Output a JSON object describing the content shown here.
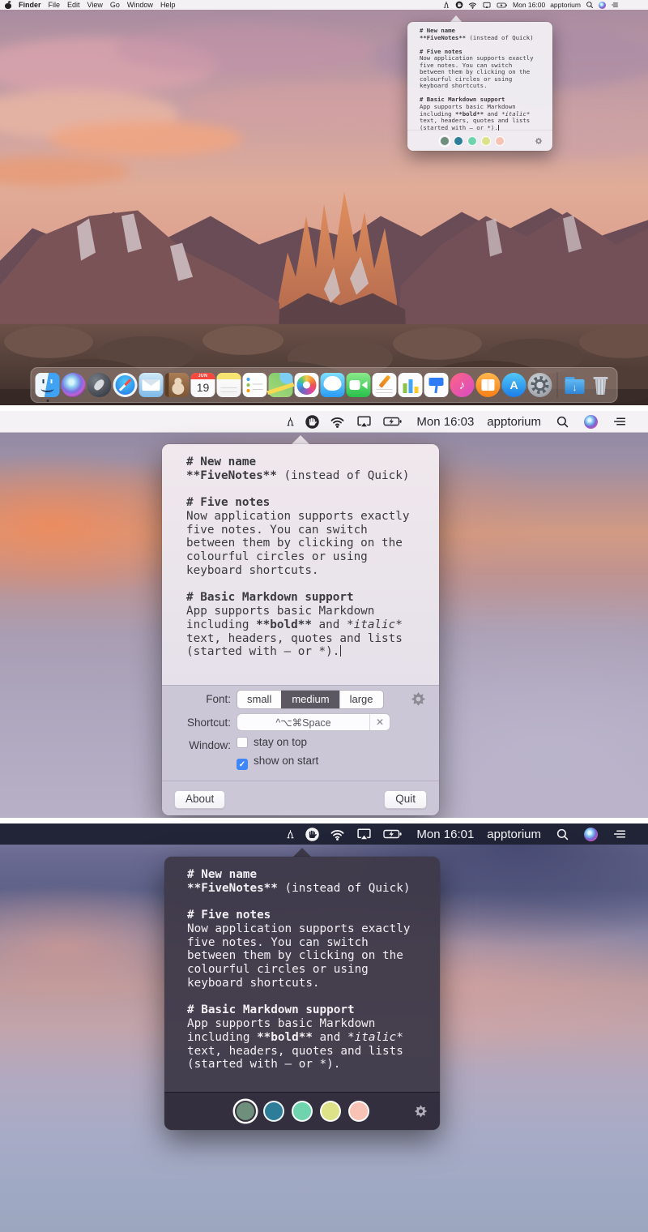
{
  "menubar_small": {
    "menus": [
      "Finder",
      "File",
      "Edit",
      "View",
      "Go",
      "Window",
      "Help"
    ],
    "time": "Mon 16:00",
    "user": "apptorium"
  },
  "menubar_light": {
    "time": "Mon 16:03",
    "user": "apptorium"
  },
  "menubar_dark": {
    "time": "Mon 16:01",
    "user": "apptorium"
  },
  "icons": {
    "menubar_status": [
      "caliper-icon",
      "fivenotes-hand-icon",
      "wifi-icon",
      "airplay-display-icon",
      "battery-charging-icon",
      "spotlight-search-icon",
      "siri-icon",
      "notification-center-icon"
    ],
    "popover": [
      "settings-gear-icon"
    ]
  },
  "note": {
    "lines": [
      [
        {
          "t": "# New name",
          "b": true
        }
      ],
      [
        {
          "t": "**FiveNotes**",
          "b": true
        },
        {
          "t": " (instead of Quick)"
        }
      ],
      [],
      [
        {
          "t": "# Five notes",
          "b": true
        }
      ],
      [
        {
          "t": "Now application supports exactly"
        }
      ],
      [
        {
          "t": "five notes. You can switch"
        }
      ],
      [
        {
          "t": "between them by clicking on the"
        }
      ],
      [
        {
          "t": "colourful circles or using"
        }
      ],
      [
        {
          "t": "keyboard shortcuts."
        }
      ],
      [],
      [
        {
          "t": "# Basic Markdown support",
          "b": true
        }
      ],
      [
        {
          "t": "App supports basic Markdown"
        }
      ],
      [
        {
          "t": "including "
        },
        {
          "t": "**bold**",
          "b": true
        },
        {
          "t": " and "
        },
        {
          "t": "*italic*",
          "i": true
        }
      ],
      [
        {
          "t": "text, headers, quotes and lists"
        }
      ],
      [
        {
          "t": "(started with — or *)."
        }
      ]
    ],
    "colors": [
      "#6f8f7d",
      "#2d7d98",
      "#6fd4ae",
      "#dde289",
      "#f8c2b4"
    ],
    "selected_index": 0
  },
  "settings": {
    "font_label": "Font:",
    "font_options": [
      "small",
      "medium",
      "large"
    ],
    "font_selected": 1,
    "shortcut_label": "Shortcut:",
    "shortcut_value": "^⌥⌘Space",
    "clear_glyph": "✕",
    "window_label": "Window:",
    "stay_on_top_label": "stay on top",
    "stay_on_top_checked": false,
    "show_on_start_label": "show on start",
    "show_on_start_checked": true,
    "check_glyph": "✓",
    "about_label": "About",
    "quit_label": "Quit"
  },
  "desktop": {
    "dock": {
      "items": [
        {
          "name": "finder",
          "label": "Finder",
          "running": true
        },
        {
          "name": "siri",
          "label": "Siri"
        },
        {
          "name": "launchpad",
          "label": "Launchpad"
        },
        {
          "name": "safari",
          "label": "Safari"
        },
        {
          "name": "mail",
          "label": "Mail"
        },
        {
          "name": "contacts",
          "label": "Contacts"
        },
        {
          "name": "calendar",
          "label": "Calendar",
          "month": "JUN",
          "day": "19"
        },
        {
          "name": "notes",
          "label": "Notes"
        },
        {
          "name": "reminders",
          "label": "Reminders"
        },
        {
          "name": "maps",
          "label": "Maps"
        },
        {
          "name": "photos",
          "label": "Photos"
        },
        {
          "name": "messages",
          "label": "Messages"
        },
        {
          "name": "facetime",
          "label": "FaceTime"
        },
        {
          "name": "pages",
          "label": "Pages"
        },
        {
          "name": "numbers",
          "label": "Numbers"
        },
        {
          "name": "keynote",
          "label": "Keynote"
        },
        {
          "name": "itunes",
          "label": "iTunes",
          "glyph": "♪"
        },
        {
          "name": "ibooks",
          "label": "iBooks"
        },
        {
          "name": "appstore",
          "label": "App Store",
          "glyph": "A"
        },
        {
          "name": "prefs",
          "label": "System Preferences"
        },
        {
          "name": "separator"
        },
        {
          "name": "downloads",
          "label": "Downloads",
          "glyph": "↓"
        },
        {
          "name": "trash",
          "label": "Trash"
        }
      ]
    }
  }
}
